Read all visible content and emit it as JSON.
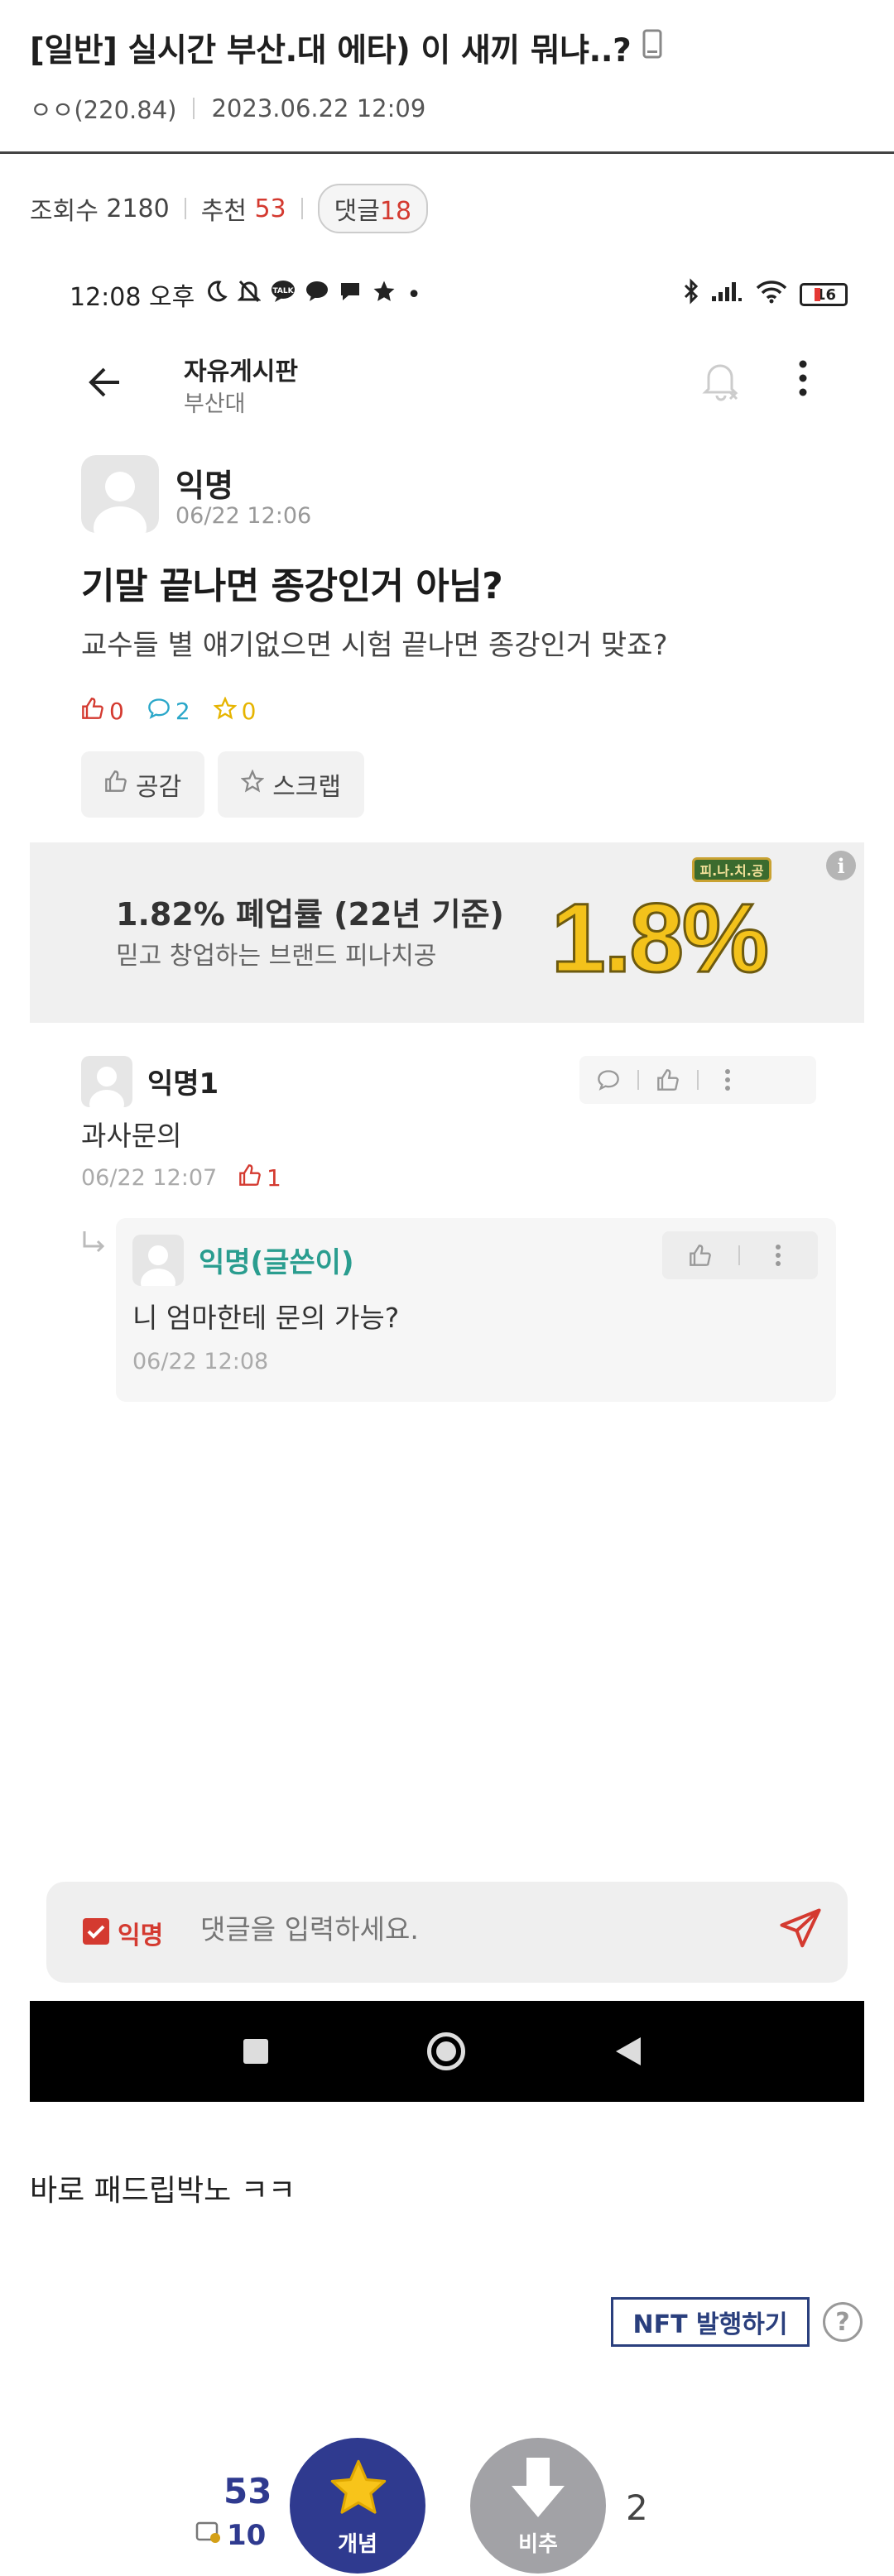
{
  "post": {
    "title": "[일반] 실시간 부산.대 에타) 이 새끼 뭐냐..?",
    "author": "ㅇㅇ(220.84)",
    "datetime": "2023.06.22 12:09",
    "views_label": "조회수",
    "views": "2180",
    "recommend_label": "추천",
    "recommend": "53",
    "comments_label": "댓글",
    "comments": "18"
  },
  "screenshot": {
    "status": {
      "time": "12:08 오후",
      "battery": "16",
      "dot": "•"
    },
    "appbar": {
      "board": "자유게시판",
      "school": "부산대"
    },
    "article": {
      "author": "익명",
      "date": "06/22 12:06",
      "title": "기말 끝나면 종강인거 아님?",
      "body": "교수들 별 얘기없으면 시험 끝나면 종강인거 맞죠?",
      "likes": "0",
      "comments": "2",
      "scraps": "0",
      "like_button": "공감",
      "scrap_button": "스크랩"
    },
    "ad": {
      "headline": "1.82% 폐업률 (22년 기준)",
      "sub": "믿고 창업하는 브랜드 피나치공",
      "big": "1.8%",
      "logo": "피.나.치.공",
      "info": "i"
    },
    "comments": [
      {
        "author": "익명1",
        "text": "과사문의",
        "date": "06/22 12:07",
        "likes": "1"
      },
      {
        "author": "익명(글쓴이)",
        "text": "니 엄마한테 문의 가능?",
        "date": "06/22 12:08"
      }
    ],
    "input": {
      "anon_label": "익명",
      "placeholder": "댓글을 입력하세요."
    }
  },
  "footer": {
    "caption": "바로 패드립박노 ㅋㅋ",
    "nft_button": "NFT 발행하기",
    "help": "?",
    "upvotes": "53",
    "fixed_upvotes": "10",
    "upvote_label": "개념",
    "downvote_label": "비추",
    "downvotes": "2"
  },
  "colors": {
    "accent_red": "#d43a30",
    "navy": "#2f3a8f",
    "teal": "#2aa7c9",
    "ad_yellow": "#f3c21b"
  }
}
